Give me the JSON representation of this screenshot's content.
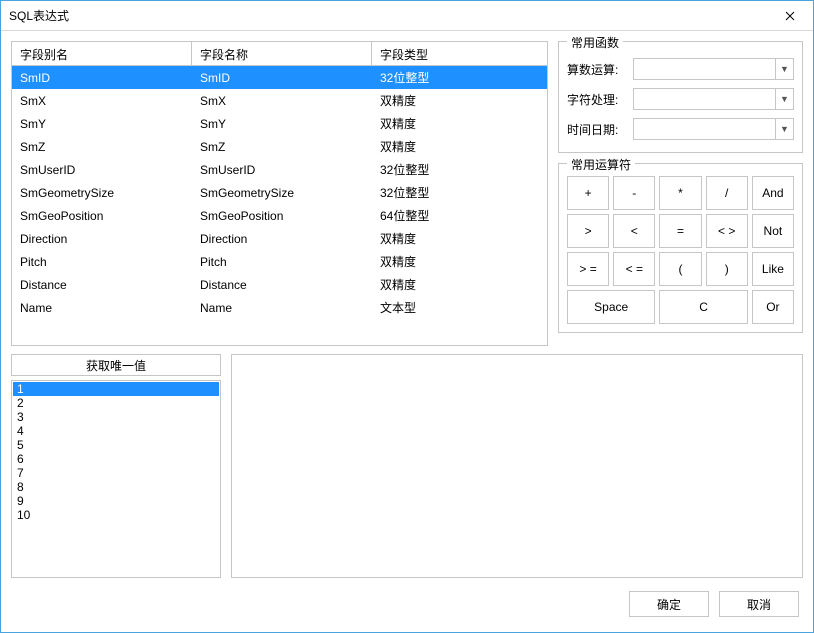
{
  "window": {
    "title": "SQL表达式"
  },
  "fields": {
    "headers": {
      "alias": "字段别名",
      "name": "字段名称",
      "type": "字段类型"
    },
    "rows": [
      {
        "alias": "SmID",
        "name": "SmID",
        "type": "32位整型",
        "selected": true
      },
      {
        "alias": "SmX",
        "name": "SmX",
        "type": "双精度"
      },
      {
        "alias": "SmY",
        "name": "SmY",
        "type": "双精度"
      },
      {
        "alias": "SmZ",
        "name": "SmZ",
        "type": "双精度"
      },
      {
        "alias": "SmUserID",
        "name": "SmUserID",
        "type": "32位整型"
      },
      {
        "alias": "SmGeometrySize",
        "name": "SmGeometrySize",
        "type": "32位整型"
      },
      {
        "alias": "SmGeoPosition",
        "name": "SmGeoPosition",
        "type": "64位整型"
      },
      {
        "alias": "Direction",
        "name": "Direction",
        "type": "双精度"
      },
      {
        "alias": "Pitch",
        "name": "Pitch",
        "type": "双精度"
      },
      {
        "alias": "Distance",
        "name": "Distance",
        "type": "双精度"
      },
      {
        "alias": "Name",
        "name": "Name",
        "type": "文本型"
      }
    ]
  },
  "functions": {
    "legend": "常用函数",
    "arith_label": "算数运算:",
    "string_label": "字符处理:",
    "datetime_label": "时间日期:",
    "arith_value": "",
    "string_value": "",
    "datetime_value": ""
  },
  "operators": {
    "legend": "常用运算符",
    "ops": [
      "+",
      "-",
      "*",
      "/",
      "And",
      ">",
      "<",
      "=",
      "< >",
      "Not",
      "> =",
      "< =",
      "(",
      ")",
      "Like"
    ],
    "space": "Space",
    "c": "C",
    "or": "Or"
  },
  "unique": {
    "button": "获取唯一值",
    "values": [
      "1",
      "2",
      "3",
      "4",
      "5",
      "6",
      "7",
      "8",
      "9",
      "10"
    ],
    "selected_index": 0
  },
  "expression": "",
  "footer": {
    "ok": "确定",
    "cancel": "取消"
  }
}
